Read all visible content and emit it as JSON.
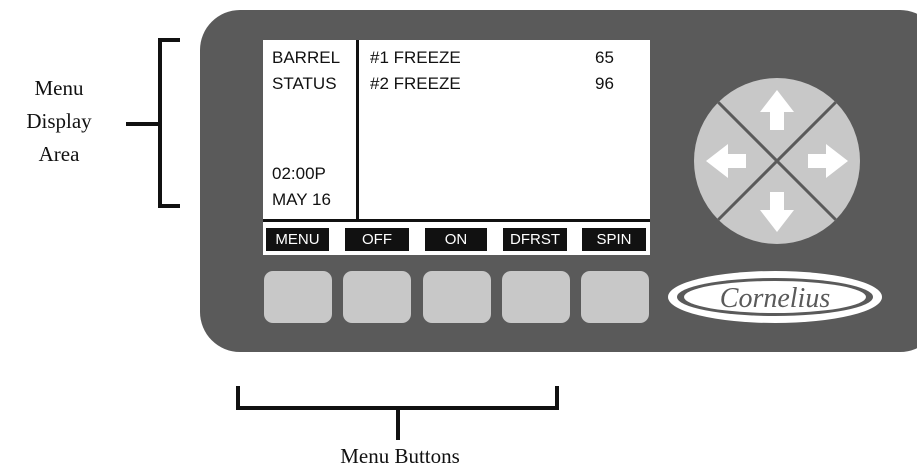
{
  "callouts": {
    "display_area": [
      "Menu",
      "Display",
      "Area"
    ],
    "buttons": "Menu Buttons"
  },
  "lcd": {
    "left_lines": [
      "BARREL",
      "STATUS"
    ],
    "time": "02:00P",
    "date": "MAY 16",
    "barrels": [
      {
        "label": "#1 FREEZE",
        "value": "65"
      },
      {
        "label": "#2 FREEZE",
        "value": "96"
      }
    ],
    "softkeys": [
      "MENU",
      "OFF",
      "ON",
      "DFRST",
      "SPIN"
    ]
  },
  "brand": {
    "logo_text": "Cornelius"
  },
  "colors": {
    "panel": "#5a5a5a",
    "button": "#c8c8c8",
    "lcd_bg": "#ffffff",
    "ink": "#111111"
  },
  "icons": [
    "arrow-up-icon",
    "arrow-down-icon",
    "arrow-left-icon",
    "arrow-right-icon"
  ]
}
